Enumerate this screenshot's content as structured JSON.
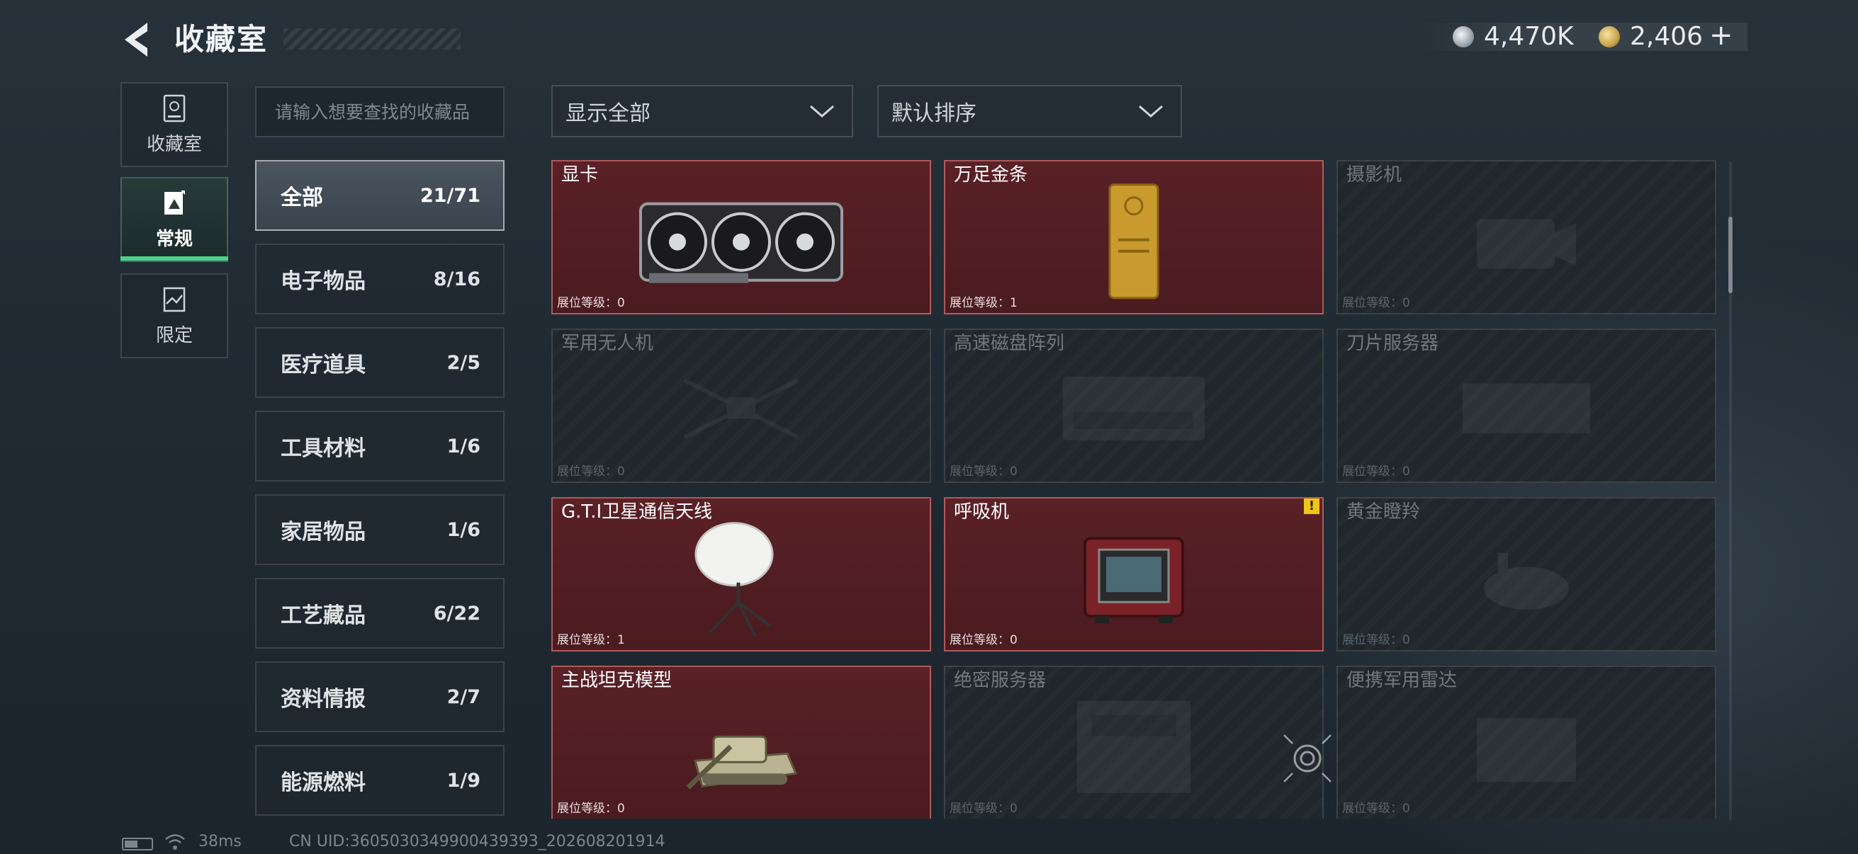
{
  "header": {
    "title": "收藏室",
    "currencies": [
      {
        "icon": "silver-coin-icon",
        "amount": "4,470K"
      },
      {
        "icon": "gold-coin-icon",
        "amount": "2,406"
      }
    ],
    "add_label": "+"
  },
  "side_tabs": [
    {
      "label": "收藏室",
      "icon": "collection-room-icon",
      "active": false
    },
    {
      "label": "常规",
      "icon": "regular-icon",
      "active": true
    },
    {
      "label": "限定",
      "icon": "limited-icon",
      "active": false
    }
  ],
  "search": {
    "placeholder": "请输入想要查找的收藏品"
  },
  "categories": [
    {
      "name": "全部",
      "count": "21/71",
      "active": true
    },
    {
      "name": "电子物品",
      "count": "8/16"
    },
    {
      "name": "医疗道具",
      "count": "2/5"
    },
    {
      "name": "工具材料",
      "count": "1/6"
    },
    {
      "name": "家居物品",
      "count": "1/6"
    },
    {
      "name": "工艺藏品",
      "count": "6/22"
    },
    {
      "name": "资料情报",
      "count": "2/7"
    },
    {
      "name": "能源燃料",
      "count": "1/9"
    }
  ],
  "filters": {
    "filter_label": "显示全部",
    "sort_label": "默认排序"
  },
  "items": [
    {
      "name": "显卡",
      "level_label": "展位等级：",
      "level": "0",
      "owned": true,
      "art": "gpu"
    },
    {
      "name": "万足金条",
      "level_label": "展位等级：",
      "level": "1",
      "owned": true,
      "art": "gold-bar"
    },
    {
      "name": "摄影机",
      "level_label": "展位等级：",
      "level": "0",
      "owned": false,
      "art": "camera"
    },
    {
      "name": "军用无人机",
      "level_label": "展位等级：",
      "level": "0",
      "owned": false,
      "art": "drone"
    },
    {
      "name": "高速磁盘阵列",
      "level_label": "展位等级：",
      "level": "0",
      "owned": false,
      "art": "disk-array"
    },
    {
      "name": "刀片服务器",
      "level_label": "展位等级：",
      "level": "0",
      "owned": false,
      "art": "blade-server"
    },
    {
      "name": "G.T.I卫星通信天线",
      "level_label": "展位等级：",
      "level": "1",
      "owned": true,
      "art": "satellite-dish"
    },
    {
      "name": "呼吸机",
      "level_label": "展位等级：",
      "level": "0",
      "owned": true,
      "art": "ventilator",
      "warning": "!"
    },
    {
      "name": "黄金瞪羚",
      "level_label": "展位等级：",
      "level": "0",
      "owned": false,
      "art": "gazelle"
    },
    {
      "name": "主战坦克模型",
      "level_label": "展位等级：",
      "level": "0",
      "owned": true,
      "art": "tank"
    },
    {
      "name": "绝密服务器",
      "level_label": "展位等级：",
      "level": "0",
      "owned": false,
      "art": "server"
    },
    {
      "name": "便携军用雷达",
      "level_label": "展位等级：",
      "level": "0",
      "owned": false,
      "art": "radar"
    }
  ],
  "status_bar": {
    "ping": "38ms",
    "uid": "CN UID:3605030349900439393_202608201914"
  },
  "colors": {
    "accent_green": "#4fd18b",
    "owned_card": "#5a2126",
    "warning": "#f0c419"
  }
}
